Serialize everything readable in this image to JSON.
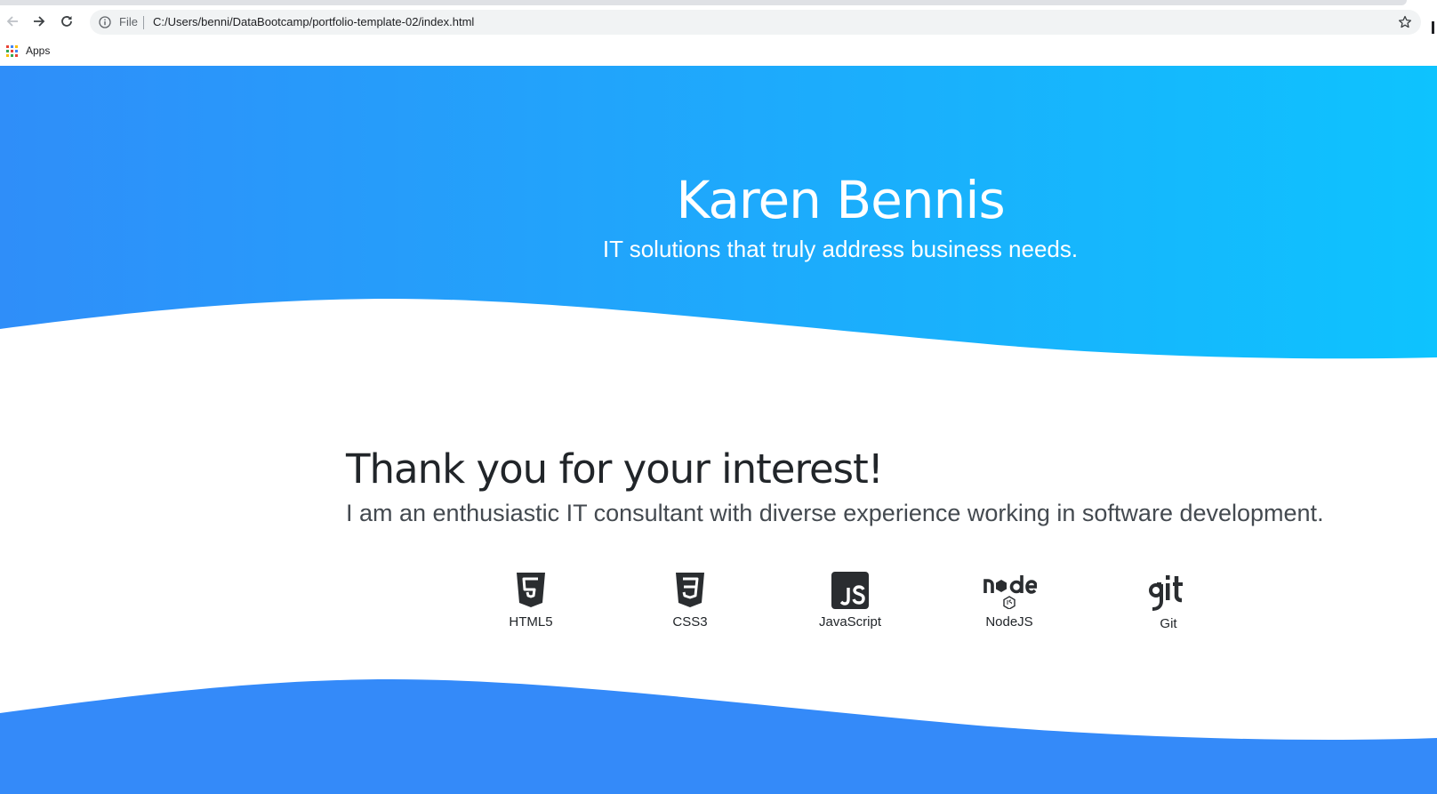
{
  "browser": {
    "scheme_label": "File",
    "url": "C:/Users/benni/DataBootcamp/portfolio-template-02/index.html",
    "bookmarks": [
      {
        "label": "Apps",
        "icon": "apps-grid-icon"
      }
    ]
  },
  "colors": {
    "hero_gradient_start": "#2f8ef9",
    "hero_gradient_end": "#0ec3fe",
    "footer_blue": "#348af9",
    "text_dark": "#212529"
  },
  "hero": {
    "title": "Karen Bennis",
    "subtitle": "IT solutions that truly address business needs."
  },
  "about": {
    "heading": "Thank you for your interest!",
    "text": "I am an enthusiastic IT consultant with diverse experience working in software development."
  },
  "skills": [
    {
      "label": "HTML5",
      "icon": "html5-icon"
    },
    {
      "label": "CSS3",
      "icon": "css3-icon"
    },
    {
      "label": "JavaScript",
      "icon": "javascript-icon"
    },
    {
      "label": "NodeJS",
      "icon": "nodejs-icon"
    },
    {
      "label": "Git",
      "icon": "git-icon"
    }
  ]
}
